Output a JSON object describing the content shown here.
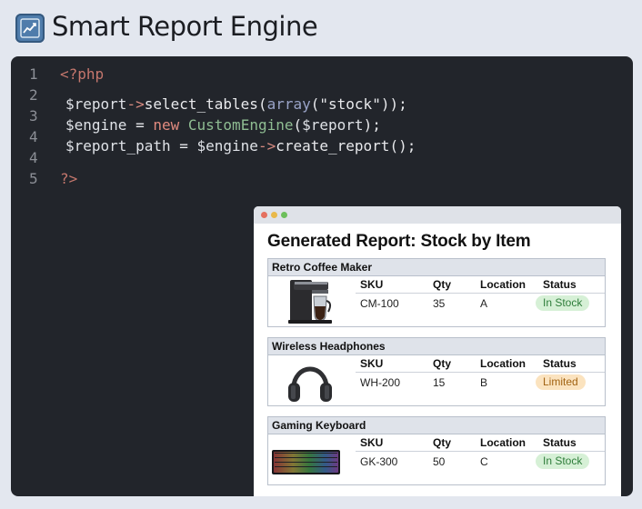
{
  "app": {
    "title": "Smart Report Engine"
  },
  "editor": {
    "line_numbers": [
      "1",
      "2",
      "3",
      "4",
      "4",
      "5"
    ],
    "lines": [
      {
        "open_tag": "<?php"
      },
      {
        "var": "$report",
        "arrow": "->",
        "method": "select_tables",
        "paren_open": "(",
        "array_kw": "array",
        "array_paren": "(",
        "string": "\"stock\"",
        "close": "));"
      },
      {
        "var": "$engine",
        "eq": " = ",
        "new_kw": "new",
        "class_name": "CustomEngine",
        "paren_open": "(",
        "arg": "$report",
        "close": ");"
      },
      {
        "var": "$report_path",
        "eq": " = ",
        "obj": "$engine",
        "arrow": "->",
        "method": "create_report",
        "close": "();"
      },
      {
        "close_tag": "?>"
      }
    ]
  },
  "report": {
    "title": "Generated Report: Stock by Item",
    "columns": {
      "sku": "SKU",
      "qty": "Qty",
      "location": "Location",
      "status": "Status"
    },
    "items": [
      {
        "name": "Retro Coffee Maker",
        "icon": "coffee-maker-image",
        "sku": "CM-100",
        "qty": "35",
        "location": "A",
        "status": "In Stock",
        "status_color": "#2e7d3a"
      },
      {
        "name": "Wireless Headphones",
        "icon": "headphones-image",
        "sku": "WH-200",
        "qty": "15",
        "location": "B",
        "status": "Limited",
        "status_color": "#a26312"
      },
      {
        "name": "Gaming Keyboard",
        "icon": "keyboard-image",
        "sku": "GK-300",
        "qty": "50",
        "location": "C",
        "status": "In Stock",
        "status_color": "#2e7d3a"
      }
    ]
  },
  "colors": {
    "editor_bg": "#22252b",
    "page_bg": "#e3e7ef",
    "accent": "#4f7cab"
  }
}
